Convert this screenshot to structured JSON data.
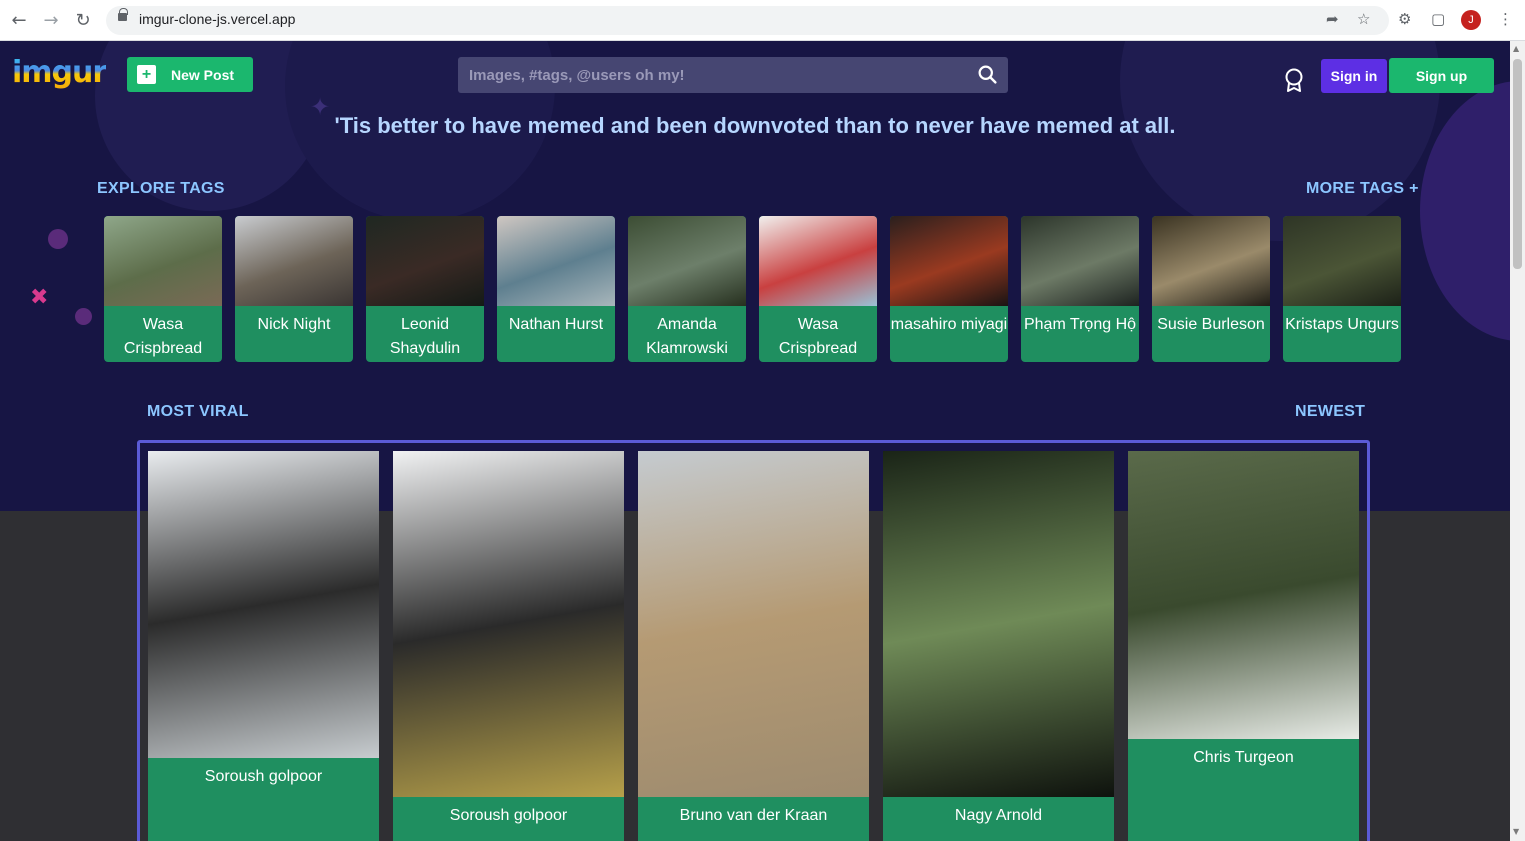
{
  "browser": {
    "url": "imgur-clone-js.vercel.app",
    "avatar_letter": "J"
  },
  "header": {
    "logo": "imgur",
    "new_post_label": "New Post",
    "search_placeholder": "Images, #tags, @users oh my!",
    "sign_in_label": "Sign in",
    "sign_up_label": "Sign up"
  },
  "tagline": "'Tis better to have memed and been downvoted than to never have memed at all.",
  "explore": {
    "title": "EXPLORE TAGS",
    "more_label": "MORE TAGS +",
    "tags": [
      {
        "name": "Wasa Crispbread",
        "colors": [
          "#8fa78a",
          "#5d6d4a",
          "#7a6a56"
        ]
      },
      {
        "name": "Nick Night",
        "colors": [
          "#c9ccd0",
          "#6d6458",
          "#3a3533"
        ]
      },
      {
        "name": "Leonid Shaydulin",
        "colors": [
          "#1f2822",
          "#3a2a25",
          "#141a16"
        ]
      },
      {
        "name": "Nathan Hurst",
        "colors": [
          "#cfc7c2",
          "#5e7f8f",
          "#a8b6bb"
        ]
      },
      {
        "name": "Amanda Klamrowski",
        "colors": [
          "#3c4d34",
          "#6d7f6a",
          "#26301f"
        ]
      },
      {
        "name": "Wasa Crispbread",
        "colors": [
          "#f1f0ee",
          "#c94040",
          "#9ac1d6"
        ]
      },
      {
        "name": "masahiro miyagi",
        "colors": [
          "#2a1f1e",
          "#9a3a20",
          "#1a1414"
        ]
      },
      {
        "name": "Phạm Trọng Hộ",
        "colors": [
          "#2c352b",
          "#6d7a66",
          "#1d2320"
        ]
      },
      {
        "name": "Susie Burleson",
        "colors": [
          "#3a3322",
          "#9a8a6a",
          "#1f1d16"
        ]
      },
      {
        "name": "Kristaps Ungurs",
        "colors": [
          "#2e3526",
          "#4b5536",
          "#1c2118"
        ]
      }
    ]
  },
  "feed": {
    "most_viral_label": "MOST VIRAL",
    "newest_label": "NEWEST",
    "posts": [
      {
        "author": "Soroush golpoor",
        "colors": [
          "#e9ecef",
          "#2b2b2b",
          "#c7cccf"
        ]
      },
      {
        "author": "Soroush golpoor",
        "colors": [
          "#f1f2f3",
          "#2a2a2a",
          "#b6a04a"
        ]
      },
      {
        "author": "Bruno van der Kraan",
        "colors": [
          "#c5cbd0",
          "#b59a73",
          "#9d8b6f"
        ]
      },
      {
        "author": "Nagy Arnold",
        "colors": [
          "#1a2417",
          "#6f8a57",
          "#0e120d"
        ]
      },
      {
        "author": "Chris Turgeon",
        "colors": [
          "#5a6a4a",
          "#3a4a2e",
          "#e7ebe6"
        ]
      }
    ]
  }
}
